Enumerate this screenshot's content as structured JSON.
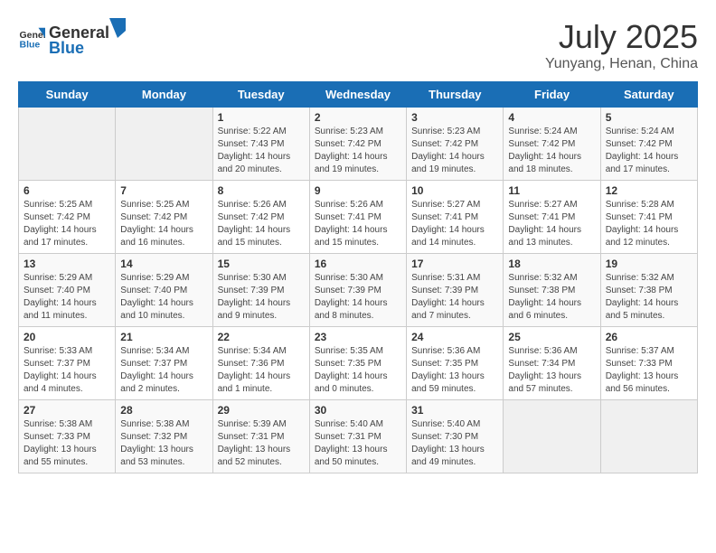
{
  "header": {
    "logo_general": "General",
    "logo_blue": "Blue",
    "title": "July 2025",
    "subtitle": "Yunyang, Henan, China"
  },
  "weekdays": [
    "Sunday",
    "Monday",
    "Tuesday",
    "Wednesday",
    "Thursday",
    "Friday",
    "Saturday"
  ],
  "weeks": [
    [
      {
        "day": "",
        "detail": ""
      },
      {
        "day": "",
        "detail": ""
      },
      {
        "day": "1",
        "detail": "Sunrise: 5:22 AM\nSunset: 7:43 PM\nDaylight: 14 hours and 20 minutes."
      },
      {
        "day": "2",
        "detail": "Sunrise: 5:23 AM\nSunset: 7:42 PM\nDaylight: 14 hours and 19 minutes."
      },
      {
        "day": "3",
        "detail": "Sunrise: 5:23 AM\nSunset: 7:42 PM\nDaylight: 14 hours and 19 minutes."
      },
      {
        "day": "4",
        "detail": "Sunrise: 5:24 AM\nSunset: 7:42 PM\nDaylight: 14 hours and 18 minutes."
      },
      {
        "day": "5",
        "detail": "Sunrise: 5:24 AM\nSunset: 7:42 PM\nDaylight: 14 hours and 17 minutes."
      }
    ],
    [
      {
        "day": "6",
        "detail": "Sunrise: 5:25 AM\nSunset: 7:42 PM\nDaylight: 14 hours and 17 minutes."
      },
      {
        "day": "7",
        "detail": "Sunrise: 5:25 AM\nSunset: 7:42 PM\nDaylight: 14 hours and 16 minutes."
      },
      {
        "day": "8",
        "detail": "Sunrise: 5:26 AM\nSunset: 7:42 PM\nDaylight: 14 hours and 15 minutes."
      },
      {
        "day": "9",
        "detail": "Sunrise: 5:26 AM\nSunset: 7:41 PM\nDaylight: 14 hours and 15 minutes."
      },
      {
        "day": "10",
        "detail": "Sunrise: 5:27 AM\nSunset: 7:41 PM\nDaylight: 14 hours and 14 minutes."
      },
      {
        "day": "11",
        "detail": "Sunrise: 5:27 AM\nSunset: 7:41 PM\nDaylight: 14 hours and 13 minutes."
      },
      {
        "day": "12",
        "detail": "Sunrise: 5:28 AM\nSunset: 7:41 PM\nDaylight: 14 hours and 12 minutes."
      }
    ],
    [
      {
        "day": "13",
        "detail": "Sunrise: 5:29 AM\nSunset: 7:40 PM\nDaylight: 14 hours and 11 minutes."
      },
      {
        "day": "14",
        "detail": "Sunrise: 5:29 AM\nSunset: 7:40 PM\nDaylight: 14 hours and 10 minutes."
      },
      {
        "day": "15",
        "detail": "Sunrise: 5:30 AM\nSunset: 7:39 PM\nDaylight: 14 hours and 9 minutes."
      },
      {
        "day": "16",
        "detail": "Sunrise: 5:30 AM\nSunset: 7:39 PM\nDaylight: 14 hours and 8 minutes."
      },
      {
        "day": "17",
        "detail": "Sunrise: 5:31 AM\nSunset: 7:39 PM\nDaylight: 14 hours and 7 minutes."
      },
      {
        "day": "18",
        "detail": "Sunrise: 5:32 AM\nSunset: 7:38 PM\nDaylight: 14 hours and 6 minutes."
      },
      {
        "day": "19",
        "detail": "Sunrise: 5:32 AM\nSunset: 7:38 PM\nDaylight: 14 hours and 5 minutes."
      }
    ],
    [
      {
        "day": "20",
        "detail": "Sunrise: 5:33 AM\nSunset: 7:37 PM\nDaylight: 14 hours and 4 minutes."
      },
      {
        "day": "21",
        "detail": "Sunrise: 5:34 AM\nSunset: 7:37 PM\nDaylight: 14 hours and 2 minutes."
      },
      {
        "day": "22",
        "detail": "Sunrise: 5:34 AM\nSunset: 7:36 PM\nDaylight: 14 hours and 1 minute."
      },
      {
        "day": "23",
        "detail": "Sunrise: 5:35 AM\nSunset: 7:35 PM\nDaylight: 14 hours and 0 minutes."
      },
      {
        "day": "24",
        "detail": "Sunrise: 5:36 AM\nSunset: 7:35 PM\nDaylight: 13 hours and 59 minutes."
      },
      {
        "day": "25",
        "detail": "Sunrise: 5:36 AM\nSunset: 7:34 PM\nDaylight: 13 hours and 57 minutes."
      },
      {
        "day": "26",
        "detail": "Sunrise: 5:37 AM\nSunset: 7:33 PM\nDaylight: 13 hours and 56 minutes."
      }
    ],
    [
      {
        "day": "27",
        "detail": "Sunrise: 5:38 AM\nSunset: 7:33 PM\nDaylight: 13 hours and 55 minutes."
      },
      {
        "day": "28",
        "detail": "Sunrise: 5:38 AM\nSunset: 7:32 PM\nDaylight: 13 hours and 53 minutes."
      },
      {
        "day": "29",
        "detail": "Sunrise: 5:39 AM\nSunset: 7:31 PM\nDaylight: 13 hours and 52 minutes."
      },
      {
        "day": "30",
        "detail": "Sunrise: 5:40 AM\nSunset: 7:31 PM\nDaylight: 13 hours and 50 minutes."
      },
      {
        "day": "31",
        "detail": "Sunrise: 5:40 AM\nSunset: 7:30 PM\nDaylight: 13 hours and 49 minutes."
      },
      {
        "day": "",
        "detail": ""
      },
      {
        "day": "",
        "detail": ""
      }
    ]
  ]
}
